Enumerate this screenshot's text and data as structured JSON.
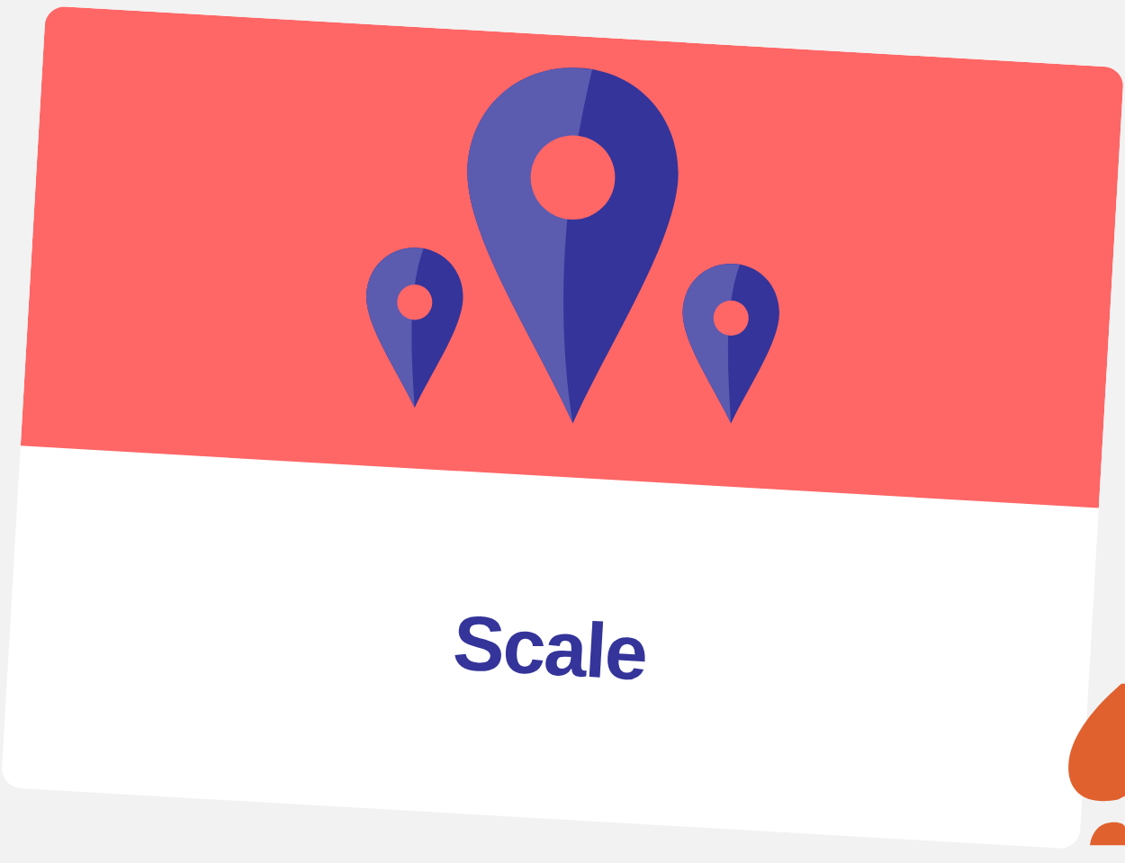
{
  "card": {
    "title": "Scale"
  }
}
